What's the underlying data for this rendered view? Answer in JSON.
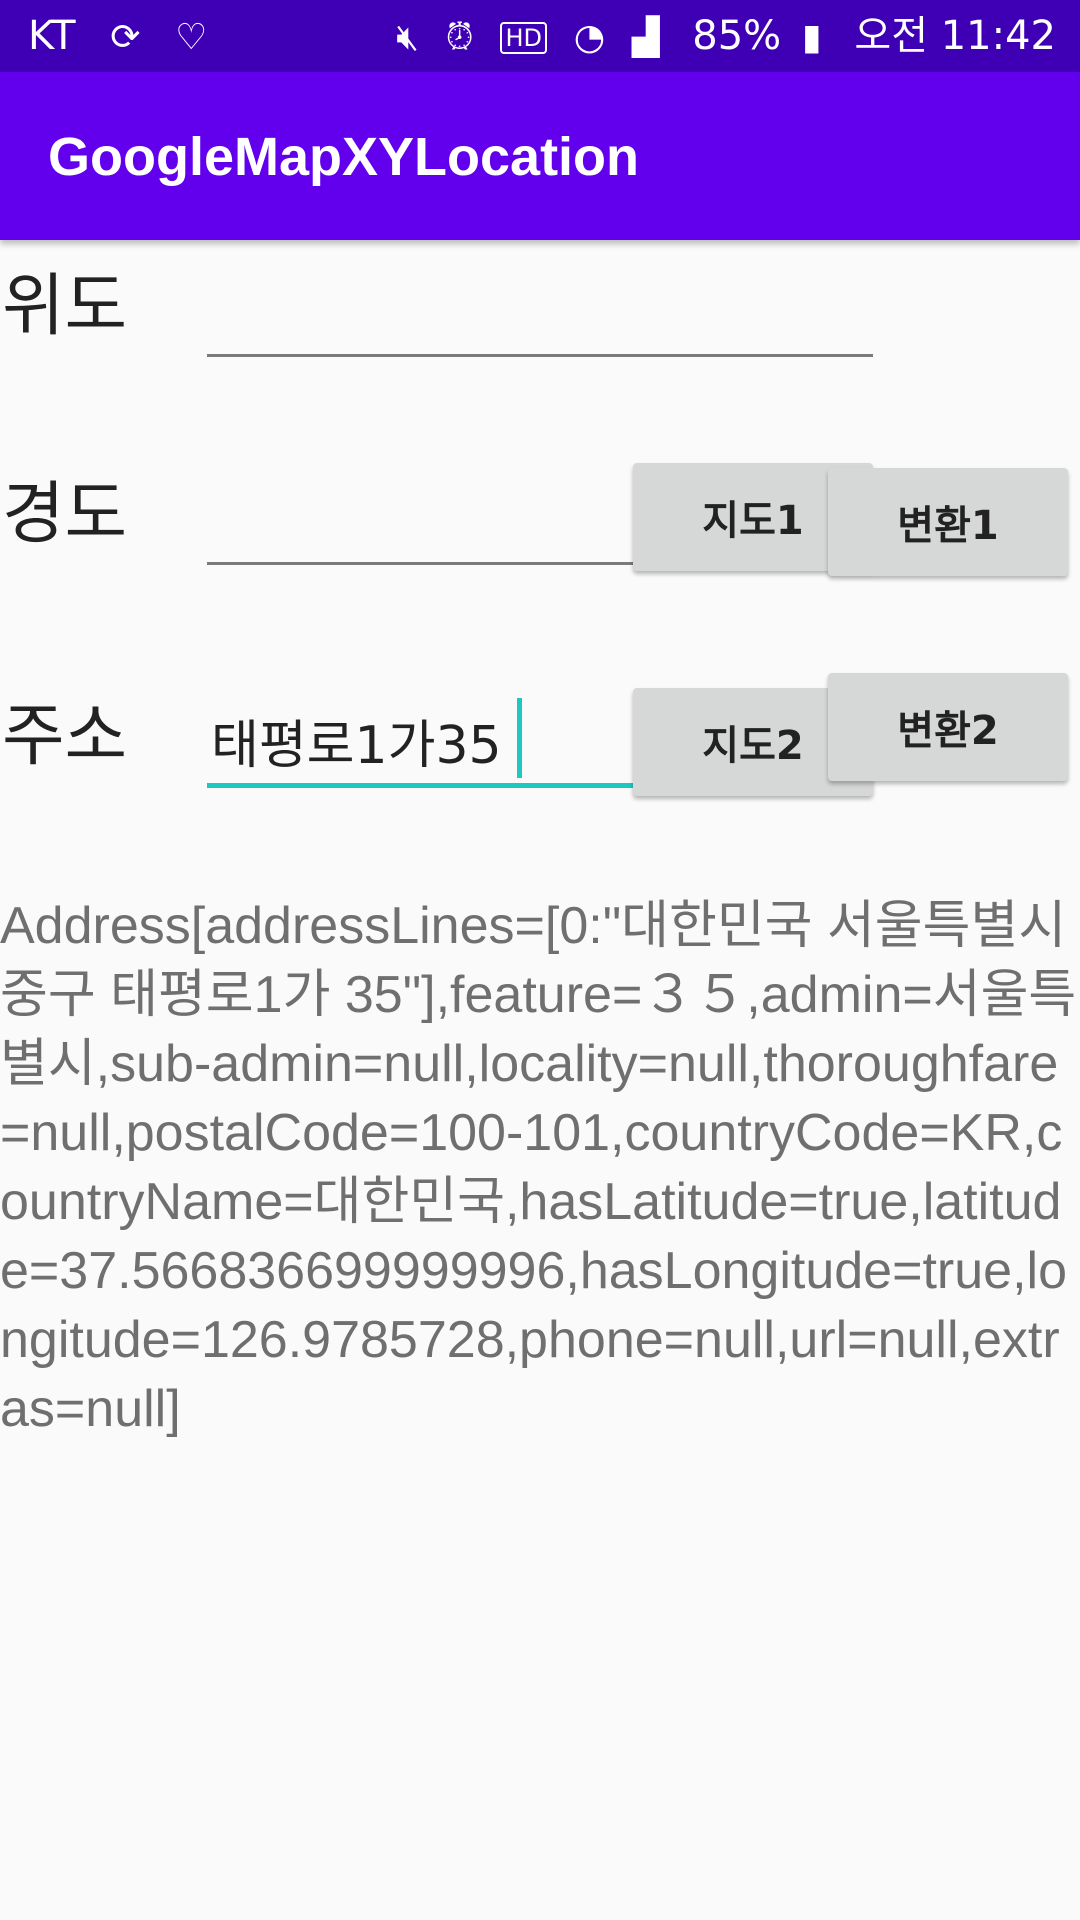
{
  "status_bar": {
    "carrier": "KT",
    "battery": "85%",
    "time": "오전 11:42",
    "icons": [
      "loop-icon",
      "link-icon",
      "mute-icon",
      "alarm-icon",
      "hd-icon",
      "wifi-icon",
      "signal-icon",
      "battery-icon"
    ]
  },
  "app_bar": {
    "title": "GoogleMapXYLocation"
  },
  "form": {
    "latitude_label": "위도",
    "latitude_value": "",
    "longitude_label": "경도",
    "longitude_value": "",
    "address_label": "주소",
    "address_value": "태평로1가35"
  },
  "buttons": {
    "map1": "지도1",
    "convert1": "변환1",
    "map2": "지도2",
    "convert2": "변환2"
  },
  "result_text": "Address[addressLines=[0:\"대한민국 서울특별시 중구 태평로1가 35\"],feature=３５,admin=서울특별시,sub-admin=null,locality=null,thoroughfare=null,postalCode=100-101,countryCode=KR,countryName=대한민국,hasLatitude=true,latitude=37.566836699999996,hasLongitude=true,longitude=126.9785728,phone=null,url=null,extras=null]",
  "colors": {
    "status_bar": "#3f00b5",
    "app_bar": "#6200ee",
    "accent": "#1fc7c1",
    "button": "#d6d7d7"
  }
}
